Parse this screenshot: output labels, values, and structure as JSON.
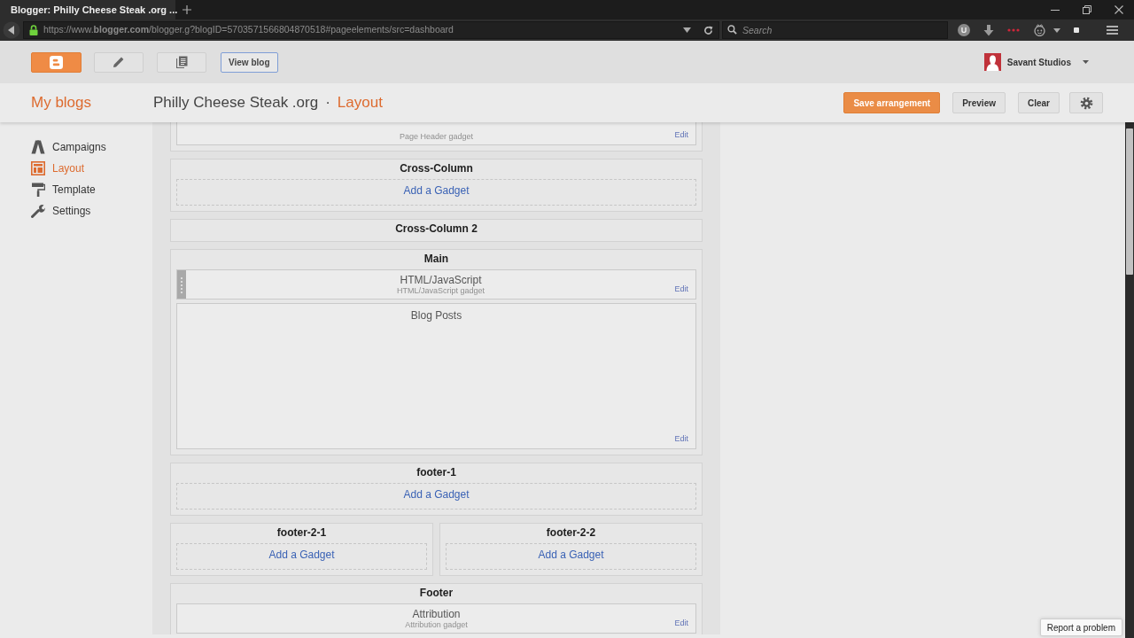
{
  "browser": {
    "tabs": [
      {
        "title": "Blogger: Philly Cheese Steak .org ...",
        "selected": true
      }
    ],
    "address": "https://www.**blogger.com**/blogger.g?blogID=5703571566804870518#pageelements/src=dashboard",
    "search": {
      "placeholder": "Search"
    },
    "extension_letter": "U"
  },
  "topbar": {
    "view_blog": "View blog",
    "account": "Savant Studios"
  },
  "header": {
    "my_blogs": "My blogs",
    "blog_title": "Philly Cheese Steak .org",
    "separator": "·",
    "page": "Layout",
    "buttons": [
      {
        "label": "Save arrangement",
        "kind": "primary"
      },
      {
        "label": "Preview",
        "kind": "default"
      },
      {
        "label": "Clear",
        "kind": "default"
      }
    ]
  },
  "sidebar": {
    "items": [
      {
        "label": "Campaigns",
        "selected": false
      },
      {
        "label": "Layout",
        "selected": true
      },
      {
        "label": "Template",
        "selected": false
      },
      {
        "label": "Settings",
        "selected": false
      }
    ]
  },
  "layout": {
    "rows": [
      {
        "sections": [
          {
            "gadgets": [
              {
                "kind": "widget",
                "subtitle": "Page Header gadget",
                "edit": "Edit",
                "drag_handle": false
              }
            ]
          }
        ]
      },
      {
        "sections": [
          {
            "title": "Cross-Column",
            "add_gadget": "Add a Gadget"
          }
        ]
      },
      {
        "sections": [
          {
            "title": "Cross-Column 2"
          }
        ]
      },
      {
        "sections": [
          {
            "title": "Main",
            "gadgets": [
              {
                "kind": "widget",
                "title": "HTML/JavaScript",
                "subtitle": "HTML/JavaScript gadget",
                "edit": "Edit",
                "drag_handle": true
              },
              {
                "kind": "posts",
                "title": "Blog Posts",
                "edit": "Edit",
                "drag_handle": false
              }
            ]
          }
        ]
      },
      {
        "sections": [
          {
            "title": "footer-1",
            "add_gadget": "Add a Gadget"
          }
        ]
      },
      {
        "sections": [
          {
            "title": "footer-2-1",
            "add_gadget": "Add a Gadget"
          },
          {
            "title": "footer-2-2",
            "add_gadget": "Add a Gadget"
          }
        ]
      },
      {
        "sections": [
          {
            "title": "Footer",
            "gadgets": [
              {
                "kind": "widget",
                "title": "Attribution",
                "subtitle": "Attribution gadget",
                "edit": "Edit",
                "drag_handle": false
              }
            ]
          }
        ]
      }
    ]
  },
  "report_problem": "Report a problem"
}
